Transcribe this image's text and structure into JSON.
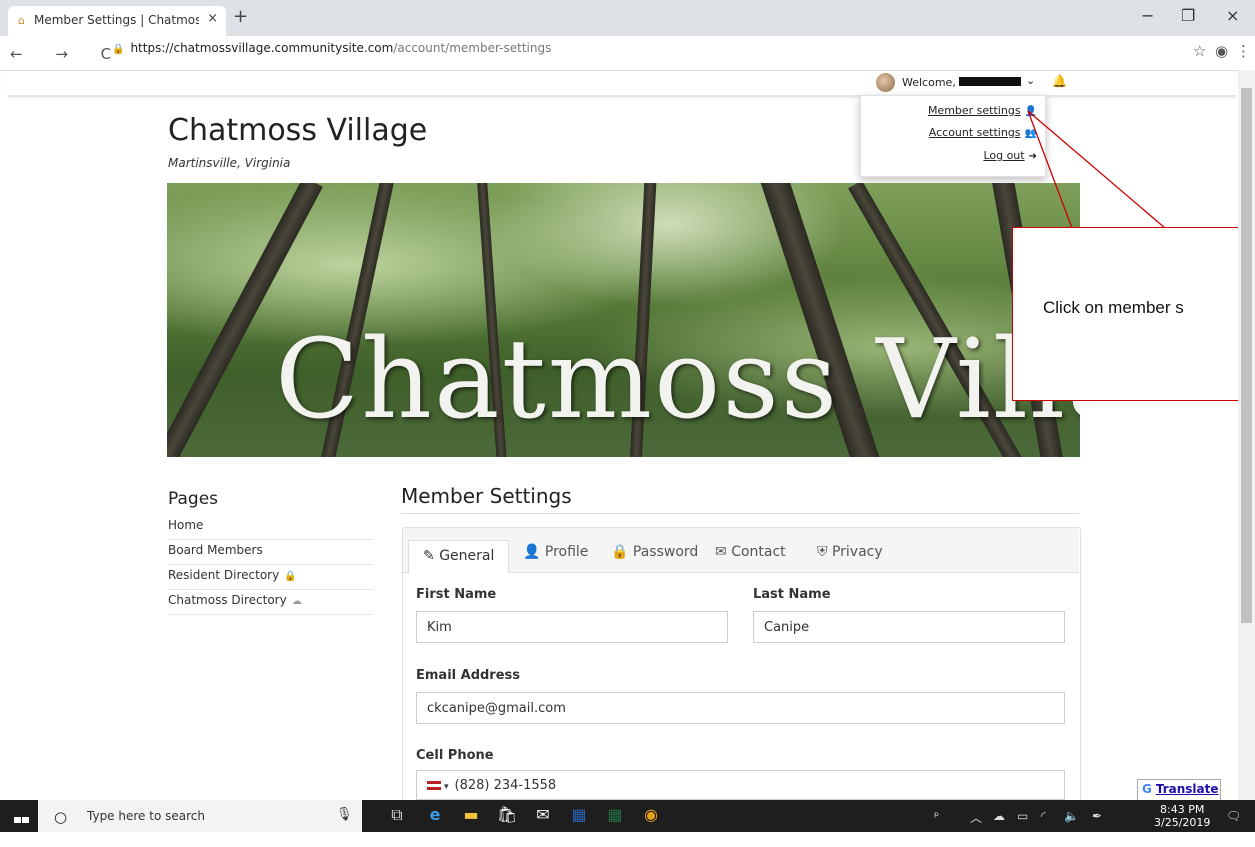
{
  "browser": {
    "tab_title": "Member Settings | Chatmoss Vill",
    "tab_close": "×",
    "new_tab": "+",
    "url_host": "https://chatmossvillage.communitysite.com",
    "url_path": "/account/member-settings",
    "nav_icons": "← → C",
    "win_min": "−",
    "win_max": "❐",
    "win_close": "×"
  },
  "header": {
    "welcome": "Welcome,",
    "member_settings": "Member settings",
    "account_settings": "Account settings",
    "logout": "Log out"
  },
  "site": {
    "title": "Chatmoss Village",
    "subtitle": "Martinsville, Virginia",
    "banner_text": "Chatmoss Village"
  },
  "sidebar": {
    "heading": "Pages",
    "items": [
      {
        "label": "Home"
      },
      {
        "label": "Board Members"
      },
      {
        "label": "Resident Directory"
      },
      {
        "label": "Chatmoss Directory"
      }
    ]
  },
  "main": {
    "heading": "Member Settings",
    "tabs": [
      {
        "label": "General",
        "icon": "edit-icon"
      },
      {
        "label": "Profile",
        "icon": "user-icon"
      },
      {
        "label": "Password",
        "icon": "lock-icon"
      },
      {
        "label": "Contact",
        "icon": "envelope-icon"
      },
      {
        "label": "Privacy",
        "icon": "shield-icon"
      }
    ],
    "form": {
      "first_name_label": "First Name",
      "first_name": "Kim",
      "last_name_label": "Last Name",
      "last_name": "Canipe",
      "email_label": "Email Address",
      "email": "ckcanipe@gmail.com",
      "cell_label": "Cell Phone",
      "cell": "(828) 234-1558"
    }
  },
  "callout": {
    "text": "Click on member s"
  },
  "translate": {
    "g": "G",
    "label": "Translate"
  },
  "taskbar": {
    "search_placeholder": "Type here to search",
    "time": "8:43 PM",
    "date": "3/25/2019"
  },
  "colors": {
    "callout_border": "#cc0000",
    "taskbar_bg": "#1e1e1e"
  }
}
